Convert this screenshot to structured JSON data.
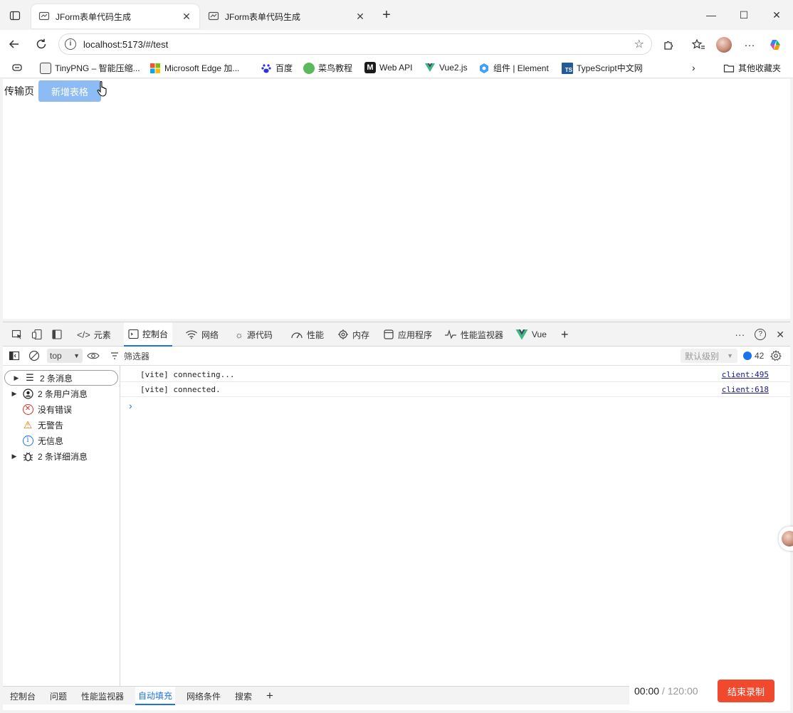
{
  "browser": {
    "tabs": [
      {
        "title": "JForm表单代码生成",
        "active": true
      },
      {
        "title": "JForm表单代码生成",
        "active": false
      }
    ],
    "window_controls": {
      "minimize": "—",
      "maximize": "☐",
      "close": "✕"
    },
    "address": {
      "url": "localhost:5173/#/test"
    },
    "bookmarks": [
      {
        "label": "TinyPNG – 智能压缩...",
        "icon": "panda-icon",
        "color": "#444444"
      },
      {
        "label": "Microsoft Edge 加...",
        "icon": "microsoft-icon",
        "color": "#f35325"
      },
      {
        "label": "百度",
        "icon": "baidu-icon",
        "color": "#2932e1"
      },
      {
        "label": "菜鸟教程",
        "icon": "runoob-icon",
        "color": "#5cb85c"
      },
      {
        "label": "Web API",
        "icon": "mdn-icon",
        "color": "#1b1b1b"
      },
      {
        "label": "Vue2.js",
        "icon": "vue-icon",
        "color": "#41b883"
      },
      {
        "label": "组件 | Element",
        "icon": "element-icon",
        "color": "#409eff"
      },
      {
        "label": "TypeScript中文网",
        "icon": "typescript-icon",
        "color": "#235a97"
      }
    ],
    "other_bookmarks": "其他收藏夹"
  },
  "page": {
    "label": "传输页",
    "add_table_button": "新增表格",
    "button_color": "#8dbcf5"
  },
  "devtools": {
    "tabs": [
      {
        "label": "元素",
        "icon": "code-icon"
      },
      {
        "label": "控制台",
        "icon": "console-icon",
        "active": true
      },
      {
        "label": "网络",
        "icon": "wifi-icon"
      },
      {
        "label": "源代码",
        "icon": "bug-icon"
      },
      {
        "label": "性能",
        "icon": "gauge-icon"
      },
      {
        "label": "内存",
        "icon": "memory-icon"
      },
      {
        "label": "应用程序",
        "icon": "application-icon"
      },
      {
        "label": "性能监视器",
        "icon": "pulse-icon"
      },
      {
        "label": "Vue",
        "icon": "vue-icon"
      }
    ],
    "console_toolbar": {
      "context": "top",
      "filter_placeholder": "筛选器",
      "level": "默认级别",
      "issues_count": "42"
    },
    "sidebar": [
      {
        "label": "2 条消息",
        "icon": "list-icon",
        "expandable": true,
        "selected": true
      },
      {
        "label": "2 条用户消息",
        "icon": "user-icon",
        "expandable": true
      },
      {
        "label": "没有错误",
        "icon": "error-icon",
        "expandable": false
      },
      {
        "label": "无警告",
        "icon": "warning-icon",
        "expandable": false
      },
      {
        "label": "无信息",
        "icon": "info-icon",
        "expandable": false
      },
      {
        "label": "2 条详细消息",
        "icon": "bug-icon",
        "expandable": true
      }
    ],
    "logs": [
      {
        "message": "[vite] connecting...",
        "source": "client:495"
      },
      {
        "message": "[vite] connected.",
        "source": "client:618"
      }
    ],
    "prompt": "›",
    "drawer_tabs": [
      {
        "label": "控制台"
      },
      {
        "label": "问题"
      },
      {
        "label": "性能监视器"
      },
      {
        "label": "自动填充",
        "active": true
      },
      {
        "label": "网络条件"
      },
      {
        "label": "搜索"
      }
    ]
  },
  "recorder": {
    "elapsed": "00:00",
    "separator": " / ",
    "total": "120:00",
    "stop_button": "结束录制",
    "button_color": "#f0492e"
  }
}
